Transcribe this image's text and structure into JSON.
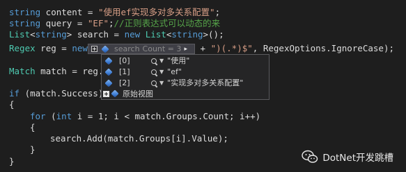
{
  "code": {
    "line1": {
      "kw": "string",
      "rest": " content = ",
      "str": "\"使用ef实现多对多关系配置\"",
      "end": ";"
    },
    "line2": {
      "kw": "string",
      "rest": " query = ",
      "str": "\"EF\"",
      "end": ";",
      "comment": "//正则表达式可以动态的来"
    },
    "line3": {
      "type1": "List",
      "lt": "<",
      "kw1": "string",
      "gt": ">",
      "rest": " search = ",
      "kw2": "new",
      "sp": " ",
      "type2": "List",
      "lt2": "<",
      "kw3": "string",
      "gt2": ">",
      "end": "();"
    },
    "line4": {
      "type": "Regex",
      "rest": " reg = ",
      "kw": "new",
      "tail_plain": " + ",
      "tail_str": "\")(.*)$\"",
      "tail_rest": ", RegexOptions.IgnoreCase);"
    },
    "line6": {
      "type": "Match",
      "rest": " match = reg.M"
    },
    "line8": {
      "kw": "if",
      "rest": " (match.Success)"
    },
    "line9": {
      "text": "{"
    },
    "line10": {
      "kw": "for",
      "p1": " (",
      "kw2": "int",
      "rest": " i = 1; i < match.Groups.Count; i++)"
    },
    "line11": {
      "text": "{"
    },
    "line12": {
      "text": "search.Add(match.Groups[i].Value);"
    },
    "line13": {
      "text": "}"
    },
    "line14": {
      "text": "}"
    }
  },
  "datatip": {
    "head_name": "search",
    "head_value": "Count = 3",
    "rows": [
      {
        "name": "[0]",
        "value": "\"使用\""
      },
      {
        "name": "[1]",
        "value": "\"ef\""
      },
      {
        "name": "[2]",
        "value": "\"实现多对多关系配置\""
      }
    ],
    "raw_view": "原始视图"
  },
  "watermark": {
    "text": "DotNet开发跳槽"
  },
  "colors": {
    "background": "#1e1e1e",
    "keyword": "#569cd6",
    "type": "#4ec9b0",
    "string": "#d69d85",
    "comment": "#57a64a"
  }
}
